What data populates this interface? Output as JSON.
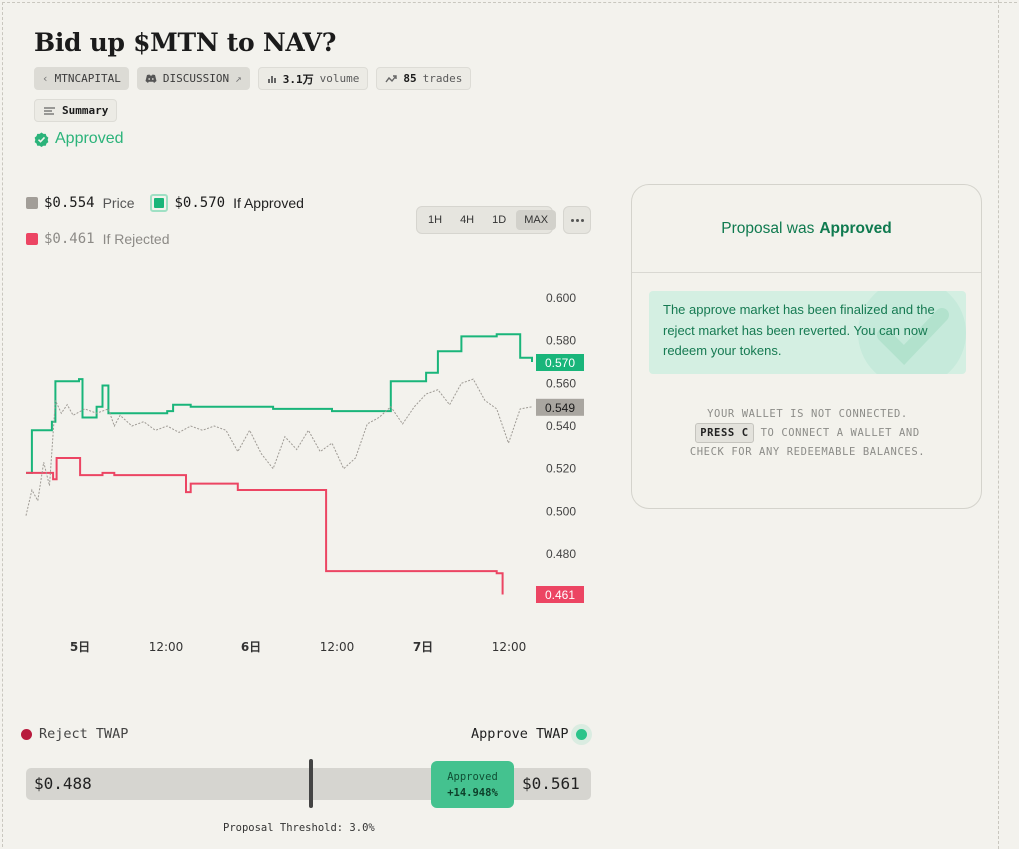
{
  "title": "Bid up $MTN to NAV?",
  "chips": {
    "org": "MTNCAPITAL",
    "discussion": "DISCUSSION",
    "volume_value": "3.1万",
    "volume_label": "volume",
    "trades_value": "85",
    "trades_label": "trades",
    "summary": "Summary"
  },
  "status": "Approved",
  "legend": {
    "price_value": "$0.554",
    "price_label": "Price",
    "approved_value": "$0.570",
    "approved_label": "If Approved",
    "rejected_value": "$0.461",
    "rejected_label": "If Rejected"
  },
  "timeframes": [
    "1H",
    "4H",
    "1D",
    "MAX"
  ],
  "active_timeframe": "MAX",
  "colors": {
    "approve": "#19b57a",
    "reject": "#ec4563",
    "price": "#9e9a94",
    "accent_dark": "#0f7a4f"
  },
  "chart_data": {
    "type": "line",
    "ylim": [
      0.46,
      0.605
    ],
    "y_ticks": [
      "0.600",
      "0.580",
      "0.560",
      "0.540",
      "0.520",
      "0.500",
      "0.480"
    ],
    "x_ticks": [
      "5日",
      "12:00",
      "6日",
      "12:00",
      "7日",
      "12:00"
    ],
    "end_labels": {
      "approved": "0.570",
      "price": "0.549",
      "rejected": "0.461"
    },
    "series": [
      {
        "name": "If Approved",
        "x": [
          0,
          0.5,
          1.5,
          2.2,
          2.5,
          4.5,
          4.8,
          6,
          6.5,
          7,
          10,
          12,
          12.5,
          14,
          18,
          21,
          26,
          30,
          31,
          33,
          34,
          35,
          37,
          40,
          42,
          43
        ],
        "y": [
          0.518,
          0.538,
          0.538,
          0.542,
          0.561,
          0.562,
          0.544,
          0.549,
          0.559,
          0.546,
          0.546,
          0.547,
          0.55,
          0.549,
          0.549,
          0.548,
          0.547,
          0.547,
          0.561,
          0.561,
          0.565,
          0.575,
          0.582,
          0.583,
          0.572,
          0.57
        ]
      },
      {
        "name": "If Rejected",
        "x": [
          0,
          1.5,
          2.3,
          2.6,
          4.2,
          4.6,
          6.2,
          6.5,
          7.5,
          13.5,
          13.6,
          14,
          18,
          25,
          25.5,
          34,
          40,
          40.5
        ],
        "y": [
          0.518,
          0.518,
          0.515,
          0.525,
          0.525,
          0.517,
          0.517,
          0.518,
          0.517,
          0.517,
          0.509,
          0.513,
          0.51,
          0.51,
          0.472,
          0.472,
          0.471,
          0.461
        ]
      },
      {
        "name": "Price",
        "x": [
          0,
          0.5,
          1,
          1.5,
          2,
          2.5,
          3,
          3.5,
          4,
          5,
          6,
          7,
          7.5,
          8,
          9,
          10,
          11,
          12,
          13,
          14,
          15,
          16,
          17,
          18,
          19,
          20,
          21,
          22,
          23,
          24,
          25,
          26,
          27,
          28,
          29,
          30,
          31,
          32,
          33,
          34,
          35,
          36,
          37,
          38,
          39,
          40,
          41,
          42,
          43
        ],
        "y": [
          0.498,
          0.51,
          0.505,
          0.523,
          0.512,
          0.552,
          0.546,
          0.55,
          0.545,
          0.548,
          0.546,
          0.548,
          0.54,
          0.545,
          0.54,
          0.542,
          0.538,
          0.54,
          0.537,
          0.54,
          0.538,
          0.54,
          0.538,
          0.528,
          0.538,
          0.527,
          0.52,
          0.535,
          0.529,
          0.538,
          0.528,
          0.532,
          0.52,
          0.525,
          0.541,
          0.544,
          0.549,
          0.541,
          0.549,
          0.555,
          0.557,
          0.55,
          0.56,
          0.562,
          0.552,
          0.548,
          0.532,
          0.548,
          0.549
        ]
      }
    ]
  },
  "card": {
    "header_prefix": "Proposal was",
    "header_status": "Approved",
    "notice": "The approve market has been finalized and the reject market has been reverted. You can now redeem your tokens.",
    "wallet_line1": "YOUR WALLET IS NOT CONNECTED.",
    "wallet_key": "PRESS C",
    "wallet_line2_rest": "TO CONNECT A WALLET AND",
    "wallet_line3": "CHECK FOR ANY REDEEMABLE BALANCES."
  },
  "twap": {
    "reject_label": "Reject TWAP",
    "approve_label": "Approve TWAP",
    "reject_value": "$0.488",
    "approve_value": "$0.561",
    "pill_label": "Approved",
    "pill_pct": "+14.948%",
    "threshold_label": "Proposal Threshold: 3.0%"
  }
}
